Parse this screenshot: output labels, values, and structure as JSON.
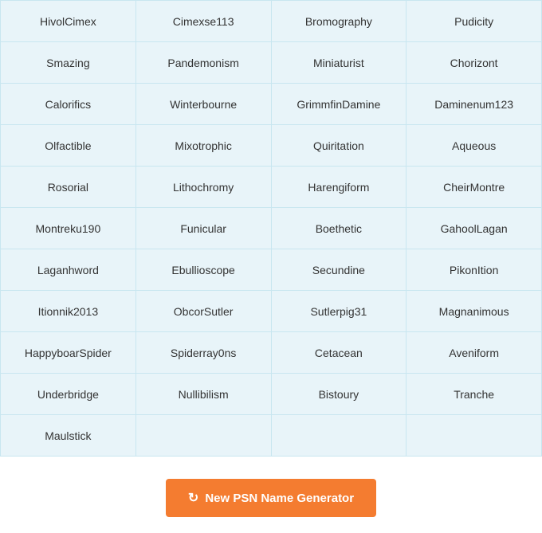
{
  "grid": {
    "cells": [
      "HivolCimex",
      "Cimexse113",
      "Bromography",
      "Pudicity",
      "Smazing",
      "Pandemonism",
      "Miniaturist",
      "Chorizont",
      "Calorifics",
      "Winterbourne",
      "GrimmfinDamine",
      "Daminenum123",
      "Olfactible",
      "Mixotrophic",
      "Quiritation",
      "Aqueous",
      "Rosorial",
      "Lithochromy",
      "Harengiform",
      "CheirMontre",
      "Montreku190",
      "Funicular",
      "Boethetic",
      "GahoolLagan",
      "Laganhword",
      "Ebullioscope",
      "Secundine",
      "PikonItion",
      "Itionnik2013",
      "ObcorSutler",
      "Sutlerpig31",
      "Magnanimous",
      "HappyboarSpider",
      "Spiderray0ns",
      "Cetacean",
      "Aveniform",
      "Underbridge",
      "Nullibilism",
      "Bistoury",
      "Tranche",
      "Maulstick"
    ],
    "empty_count": 3
  },
  "button": {
    "label": "New PSN Name Generator",
    "icon": "refresh-icon"
  }
}
